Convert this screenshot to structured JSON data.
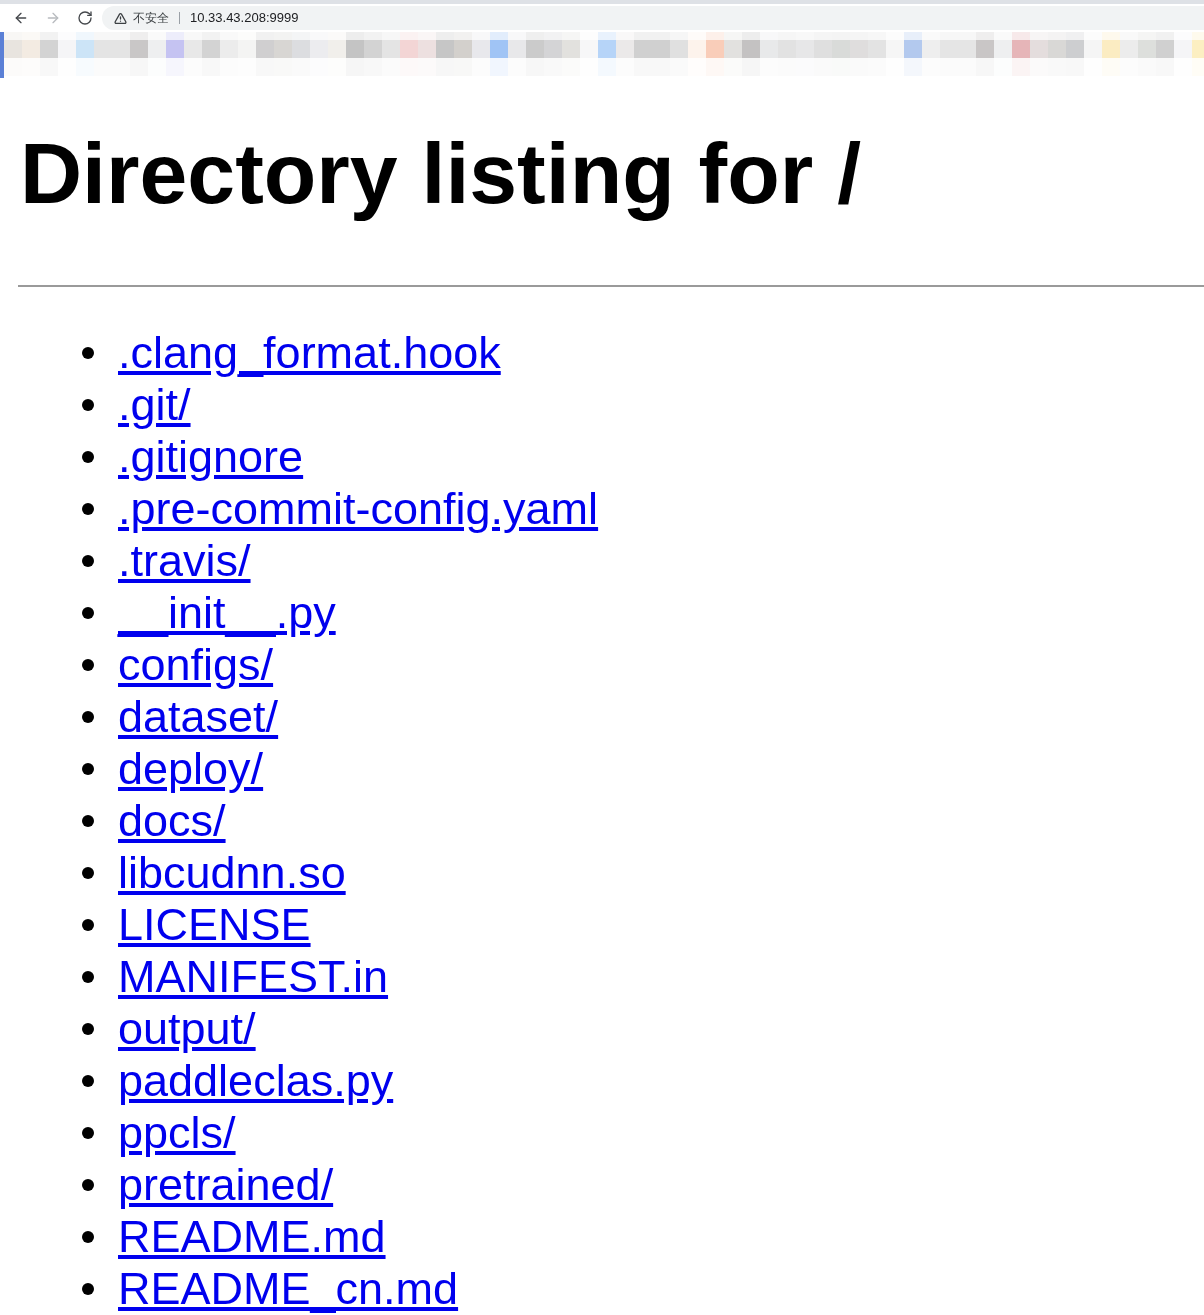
{
  "browser": {
    "nav_buttons": [
      {
        "kind": "back",
        "disabled": false
      },
      {
        "kind": "forward",
        "disabled": true
      },
      {
        "kind": "reload",
        "disabled": false
      }
    ],
    "security_label": "不安全",
    "url": "10.33.43.208:9999"
  },
  "page": {
    "title": "Directory listing for /",
    "entries": [
      ".clang_format.hook",
      ".git/",
      ".gitignore",
      ".pre-commit-config.yaml",
      ".travis/",
      "__init__.py",
      "configs/",
      "dataset/",
      "deploy/",
      "docs/",
      "libcudnn.so",
      "LICENSE",
      "MANIFEST.in",
      "output/",
      "paddleclas.py",
      "ppcls/",
      "pretrained/",
      "README.md",
      "README_cn.md"
    ]
  }
}
